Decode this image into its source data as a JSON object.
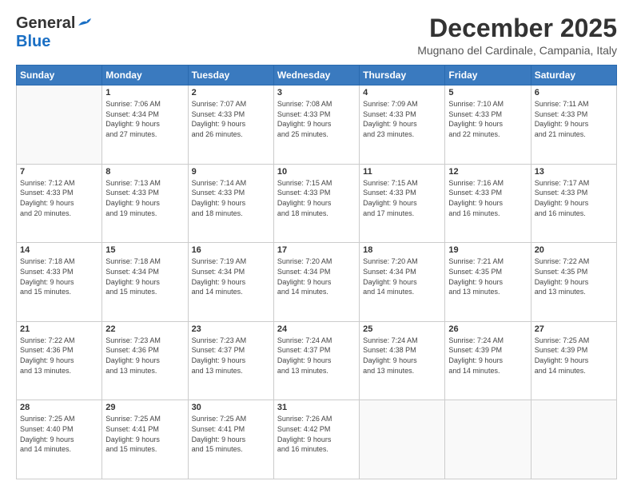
{
  "logo": {
    "line1": "General",
    "line2": "Blue"
  },
  "title": "December 2025",
  "location": "Mugnano del Cardinale, Campania, Italy",
  "days_of_week": [
    "Sunday",
    "Monday",
    "Tuesday",
    "Wednesday",
    "Thursday",
    "Friday",
    "Saturday"
  ],
  "weeks": [
    [
      {
        "day": "",
        "info": ""
      },
      {
        "day": "1",
        "info": "Sunrise: 7:06 AM\nSunset: 4:34 PM\nDaylight: 9 hours\nand 27 minutes."
      },
      {
        "day": "2",
        "info": "Sunrise: 7:07 AM\nSunset: 4:33 PM\nDaylight: 9 hours\nand 26 minutes."
      },
      {
        "day": "3",
        "info": "Sunrise: 7:08 AM\nSunset: 4:33 PM\nDaylight: 9 hours\nand 25 minutes."
      },
      {
        "day": "4",
        "info": "Sunrise: 7:09 AM\nSunset: 4:33 PM\nDaylight: 9 hours\nand 23 minutes."
      },
      {
        "day": "5",
        "info": "Sunrise: 7:10 AM\nSunset: 4:33 PM\nDaylight: 9 hours\nand 22 minutes."
      },
      {
        "day": "6",
        "info": "Sunrise: 7:11 AM\nSunset: 4:33 PM\nDaylight: 9 hours\nand 21 minutes."
      }
    ],
    [
      {
        "day": "7",
        "info": "Sunrise: 7:12 AM\nSunset: 4:33 PM\nDaylight: 9 hours\nand 20 minutes."
      },
      {
        "day": "8",
        "info": "Sunrise: 7:13 AM\nSunset: 4:33 PM\nDaylight: 9 hours\nand 19 minutes."
      },
      {
        "day": "9",
        "info": "Sunrise: 7:14 AM\nSunset: 4:33 PM\nDaylight: 9 hours\nand 18 minutes."
      },
      {
        "day": "10",
        "info": "Sunrise: 7:15 AM\nSunset: 4:33 PM\nDaylight: 9 hours\nand 18 minutes."
      },
      {
        "day": "11",
        "info": "Sunrise: 7:15 AM\nSunset: 4:33 PM\nDaylight: 9 hours\nand 17 minutes."
      },
      {
        "day": "12",
        "info": "Sunrise: 7:16 AM\nSunset: 4:33 PM\nDaylight: 9 hours\nand 16 minutes."
      },
      {
        "day": "13",
        "info": "Sunrise: 7:17 AM\nSunset: 4:33 PM\nDaylight: 9 hours\nand 16 minutes."
      }
    ],
    [
      {
        "day": "14",
        "info": "Sunrise: 7:18 AM\nSunset: 4:33 PM\nDaylight: 9 hours\nand 15 minutes."
      },
      {
        "day": "15",
        "info": "Sunrise: 7:18 AM\nSunset: 4:34 PM\nDaylight: 9 hours\nand 15 minutes."
      },
      {
        "day": "16",
        "info": "Sunrise: 7:19 AM\nSunset: 4:34 PM\nDaylight: 9 hours\nand 14 minutes."
      },
      {
        "day": "17",
        "info": "Sunrise: 7:20 AM\nSunset: 4:34 PM\nDaylight: 9 hours\nand 14 minutes."
      },
      {
        "day": "18",
        "info": "Sunrise: 7:20 AM\nSunset: 4:34 PM\nDaylight: 9 hours\nand 14 minutes."
      },
      {
        "day": "19",
        "info": "Sunrise: 7:21 AM\nSunset: 4:35 PM\nDaylight: 9 hours\nand 13 minutes."
      },
      {
        "day": "20",
        "info": "Sunrise: 7:22 AM\nSunset: 4:35 PM\nDaylight: 9 hours\nand 13 minutes."
      }
    ],
    [
      {
        "day": "21",
        "info": "Sunrise: 7:22 AM\nSunset: 4:36 PM\nDaylight: 9 hours\nand 13 minutes."
      },
      {
        "day": "22",
        "info": "Sunrise: 7:23 AM\nSunset: 4:36 PM\nDaylight: 9 hours\nand 13 minutes."
      },
      {
        "day": "23",
        "info": "Sunrise: 7:23 AM\nSunset: 4:37 PM\nDaylight: 9 hours\nand 13 minutes."
      },
      {
        "day": "24",
        "info": "Sunrise: 7:24 AM\nSunset: 4:37 PM\nDaylight: 9 hours\nand 13 minutes."
      },
      {
        "day": "25",
        "info": "Sunrise: 7:24 AM\nSunset: 4:38 PM\nDaylight: 9 hours\nand 13 minutes."
      },
      {
        "day": "26",
        "info": "Sunrise: 7:24 AM\nSunset: 4:39 PM\nDaylight: 9 hours\nand 14 minutes."
      },
      {
        "day": "27",
        "info": "Sunrise: 7:25 AM\nSunset: 4:39 PM\nDaylight: 9 hours\nand 14 minutes."
      }
    ],
    [
      {
        "day": "28",
        "info": "Sunrise: 7:25 AM\nSunset: 4:40 PM\nDaylight: 9 hours\nand 14 minutes."
      },
      {
        "day": "29",
        "info": "Sunrise: 7:25 AM\nSunset: 4:41 PM\nDaylight: 9 hours\nand 15 minutes."
      },
      {
        "day": "30",
        "info": "Sunrise: 7:25 AM\nSunset: 4:41 PM\nDaylight: 9 hours\nand 15 minutes."
      },
      {
        "day": "31",
        "info": "Sunrise: 7:26 AM\nSunset: 4:42 PM\nDaylight: 9 hours\nand 16 minutes."
      },
      {
        "day": "",
        "info": ""
      },
      {
        "day": "",
        "info": ""
      },
      {
        "day": "",
        "info": ""
      }
    ]
  ]
}
